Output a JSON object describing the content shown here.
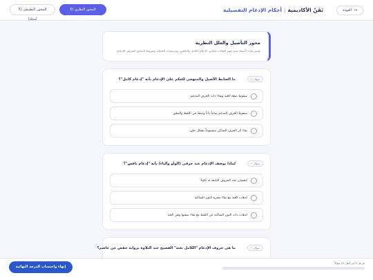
{
  "header": {
    "back_label": "العودة",
    "title_main": "تَقَنْ الأكاديمية",
    "title_sep": "|",
    "title_course": "أحكام الإدغام التفصيلية",
    "tabs": [
      {
        "label": "المحور النظري (5 أسئلة)",
        "active": true
      },
      {
        "label": "المحور التطبيقي (5 أسئلة)",
        "active": false
      }
    ]
  },
  "intro": {
    "heading": "محور التأصيل والعلل النظرية",
    "description": "تقيس هذه الأسئلة مدى فهم الطالب لمعايير الإدغام الكامل والناقص، ومرجعيات العلماء، وشروط التحقق الصرفي للإدغام."
  },
  "questions": [
    {
      "badge": "سؤال",
      "text": "ما الضابط الأصيل والمنهجي للحكم على الإدغام بأنه \"إدغام كامل\"؟",
      "options": [
        "سقوط صفة الغنة وبقاء ذات الحرف المدغم",
        "سقوط الحرف المدغم تماماً ذاتاً وصفةً في اللفظ والنطق",
        "بقاء أثر الحرف الساكن مسموعاً بشكل جلي"
      ]
    },
    {
      "badge": "سؤال",
      "text": "لماذا يوصف الإدغام عند حرفي (الواو والياء) بأنه \"إدغام ناقص\"؟",
      "options": [
        "لنقصان عدد الحروف التابعة له تلاوةً",
        "لذهاب الغنة مع بقاء مخرج النون الساكنة",
        "لذهاب ذات النون الساكنة من اللفظ مع بقاء صفتها وهي الغنة"
      ]
    },
    {
      "badge": "سؤال",
      "text": "ما هي حروف الإدغام \"الكامل بغنة\" الفصيح عند التلاوة برواية حفص عن عاصم؟",
      "options": []
    }
  ],
  "footer": {
    "finish_label": "إنهاء واحتساب الدرجة النهائية",
    "progress_text": "تم حل 0 من أصل 15 سؤالاً",
    "progress_value": 0
  },
  "colors": {
    "accent": "#5b5ee6",
    "primary_button": "#2a57c9"
  }
}
